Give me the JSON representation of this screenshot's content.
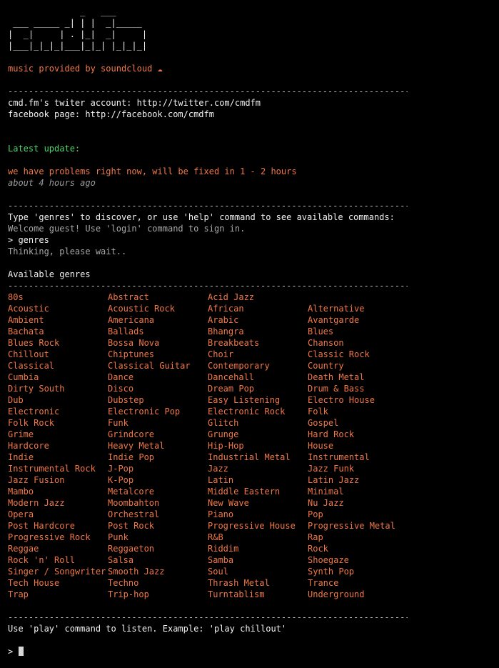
{
  "logo_ascii": "              _   ___\n ___ _____ _| | |  _|_____\n|  _|     | . |_|  _|     |\n|___|_|_|_|___|_|_| |_|_|_|",
  "soundcloud_line": "music provided by soundcloud ☁",
  "divider": "-------------------------------------------------------------------------------",
  "twitter_line": "cmd.fm's twiter account: http://twitter.com/cmdfm",
  "facebook_line": "facebook page: http://facebook.com/cmdfm",
  "latest_update_label": "Latest update:",
  "update_message": "we have problems right now, will be fixed in 1 - 2 hours",
  "update_time": "about 4 hours ago",
  "instructions": "Type 'genres' to discover, or use 'help' command to see available commands:",
  "welcome": "Welcome guest! Use 'login' command to sign in.",
  "entered_command": "> genres",
  "thinking": "Thinking, please wait..",
  "available_genres_label": "Available genres",
  "genres": [
    "80s",
    "Abstract",
    "Acid Jazz",
    "",
    "Acoustic",
    "Acoustic Rock",
    "African",
    "Alternative",
    "Ambient",
    "Americana",
    "Arabic",
    "Avantgarde",
    "Bachata",
    "Ballads",
    "Bhangra",
    "Blues",
    "Blues Rock",
    "Bossa Nova",
    "Breakbeats",
    "Chanson",
    "Chillout",
    "Chiptunes",
    "Choir",
    "Classic Rock",
    "Classical",
    "Classical Guitar",
    "Contemporary",
    "Country",
    "Cumbia",
    "Dance",
    "Dancehall",
    "Death Metal",
    "Dirty South",
    "Disco",
    "Dream Pop",
    "Drum & Bass",
    "Dub",
    "Dubstep",
    "Easy Listening",
    "Electro House",
    "Electronic",
    "Electronic Pop",
    "Electronic Rock",
    "Folk",
    "Folk Rock",
    "Funk",
    "Glitch",
    "Gospel",
    "Grime",
    "Grindcore",
    "Grunge",
    "Hard Rock",
    "Hardcore",
    "Heavy Metal",
    "Hip-Hop",
    "House",
    "Indie",
    "Indie Pop",
    "Industrial Metal",
    "Instrumental",
    "Instrumental Rock",
    "J-Pop",
    "Jazz",
    "Jazz Funk",
    "Jazz Fusion",
    "K-Pop",
    "Latin",
    "Latin Jazz",
    "Mambo",
    "Metalcore",
    "Middle Eastern",
    "Minimal",
    "Modern Jazz",
    "Moombahton",
    "New Wave",
    "Nu Jazz",
    "Opera",
    "Orchestral",
    "Piano",
    "Pop",
    "Post Hardcore",
    "Post Rock",
    "Progressive House",
    "Progressive Metal",
    "Progressive Rock",
    "Punk",
    "R&B",
    "Rap",
    "Reggae",
    "Reggaeton",
    "Riddim",
    "Rock",
    "Rock 'n' Roll",
    "Salsa",
    "Samba",
    "Shoegaze",
    "Singer / Songwriter",
    "Smooth Jazz",
    "Soul",
    "Synth Pop",
    "Tech House",
    "Techno",
    "Thrash Metal",
    "Trance",
    "Trap",
    "Trip-hop",
    "Turntablism",
    "Underground"
  ],
  "play_hint": "Use 'play' command to listen. Example: 'play chillout'",
  "prompt": "> ",
  "colors": {
    "background": "#000000",
    "accent_orange": "#f07746",
    "update_green": "#4ed66a",
    "text_white": "#f2f2f2",
    "text_gray": "#a8a8a8"
  }
}
